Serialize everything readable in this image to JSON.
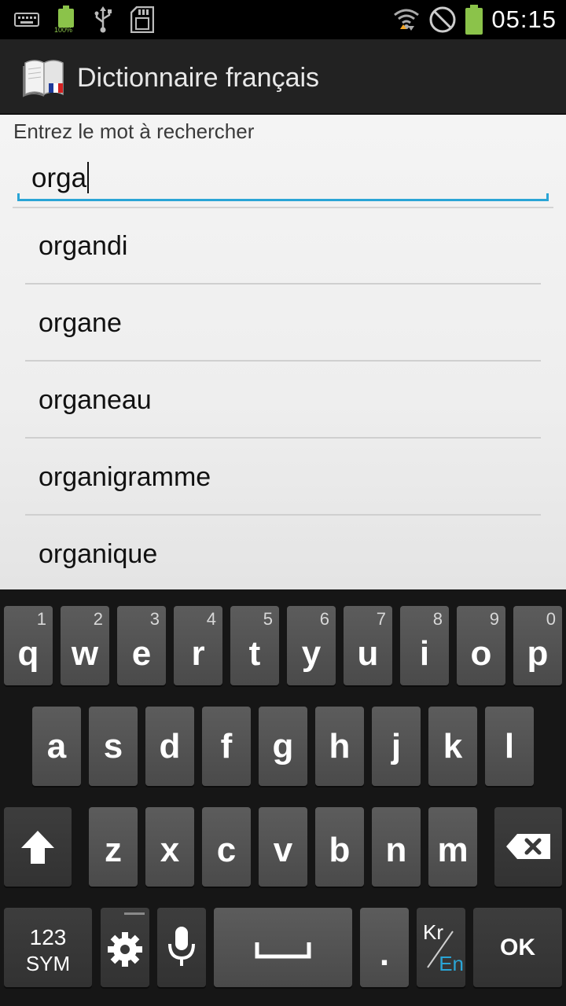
{
  "status_bar": {
    "time": "05:15",
    "battery_label": "100%",
    "icons": [
      "keyboard-icon",
      "battery-full-icon",
      "usb-icon",
      "sd-card-icon",
      "wifi-icon",
      "no-sim-icon",
      "battery-icon"
    ]
  },
  "action_bar": {
    "title": "Dictionnaire français",
    "icon": "dictionary-book-icon"
  },
  "search": {
    "label": "Entrez le mot à rechercher",
    "value": "orga"
  },
  "results": [
    "organdi",
    "organe",
    "organeau",
    "organigramme",
    "organique"
  ],
  "keyboard": {
    "row1": [
      {
        "key": "q",
        "num": "1"
      },
      {
        "key": "w",
        "num": "2"
      },
      {
        "key": "e",
        "num": "3"
      },
      {
        "key": "r",
        "num": "4"
      },
      {
        "key": "t",
        "num": "5"
      },
      {
        "key": "y",
        "num": "6"
      },
      {
        "key": "u",
        "num": "7"
      },
      {
        "key": "i",
        "num": "8"
      },
      {
        "key": "o",
        "num": "9"
      },
      {
        "key": "p",
        "num": "0"
      }
    ],
    "row2": [
      "a",
      "s",
      "d",
      "f",
      "g",
      "h",
      "j",
      "k",
      "l"
    ],
    "row3": [
      "z",
      "x",
      "c",
      "v",
      "b",
      "n",
      "m"
    ],
    "sym_label_top": "123",
    "sym_label_bottom": "SYM",
    "period": ".",
    "lang_top": "Kr",
    "lang_bottom": "En",
    "ok": "OK"
  },
  "colors": {
    "accent": "#2aa5d6",
    "action_bar": "#222222",
    "battery": "#8bc34a",
    "key": "#4f4f4f"
  }
}
